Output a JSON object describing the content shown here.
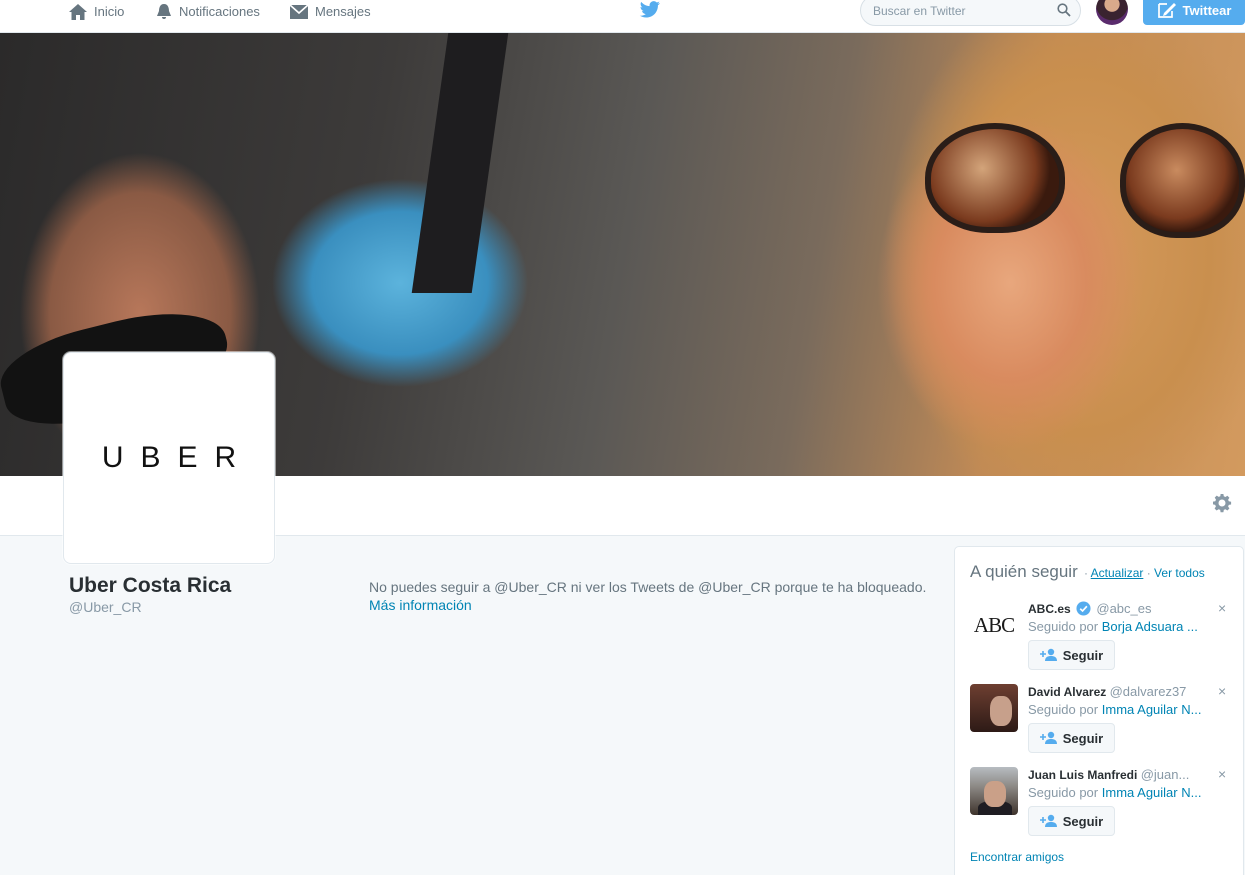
{
  "nav": {
    "home": "Inicio",
    "notifications": "Notificaciones",
    "messages": "Mensajes",
    "search_placeholder": "Buscar en Twitter",
    "tweet_button": "Twittear"
  },
  "profile": {
    "logo_text": "UBER",
    "name": "Uber Costa Rica",
    "handle": "@Uber_CR",
    "blocked_message": "No puedes seguir a @Uber_CR ni ver los Tweets de @Uber_CR porque te ha bloqueado.",
    "more_info": "Más información"
  },
  "who_to_follow": {
    "title": "A quién seguir",
    "separator": "·",
    "refresh": "Actualizar",
    "view_all": "Ver todos",
    "followed_prefix": "Seguido por",
    "follow_label": "Seguir",
    "dismiss": "×",
    "find_friends": "Encontrar amigos",
    "users": [
      {
        "name": "ABC.es",
        "handle": "@abc_es",
        "verified": true,
        "avatar_text": "ABC",
        "followed_by": "Borja Adsuara ..."
      },
      {
        "name": "David Alvarez",
        "handle": "@dalvarez37",
        "verified": false,
        "followed_by": "Imma Aguilar N..."
      },
      {
        "name": "Juan Luis Manfredi",
        "handle": "@juan...",
        "verified": false,
        "followed_by": "Imma Aguilar N..."
      }
    ]
  },
  "colors": {
    "brand_blue": "#55acee",
    "link_blue": "#0084b4",
    "muted_gray": "#8899a6",
    "text_dark": "#292f33"
  }
}
